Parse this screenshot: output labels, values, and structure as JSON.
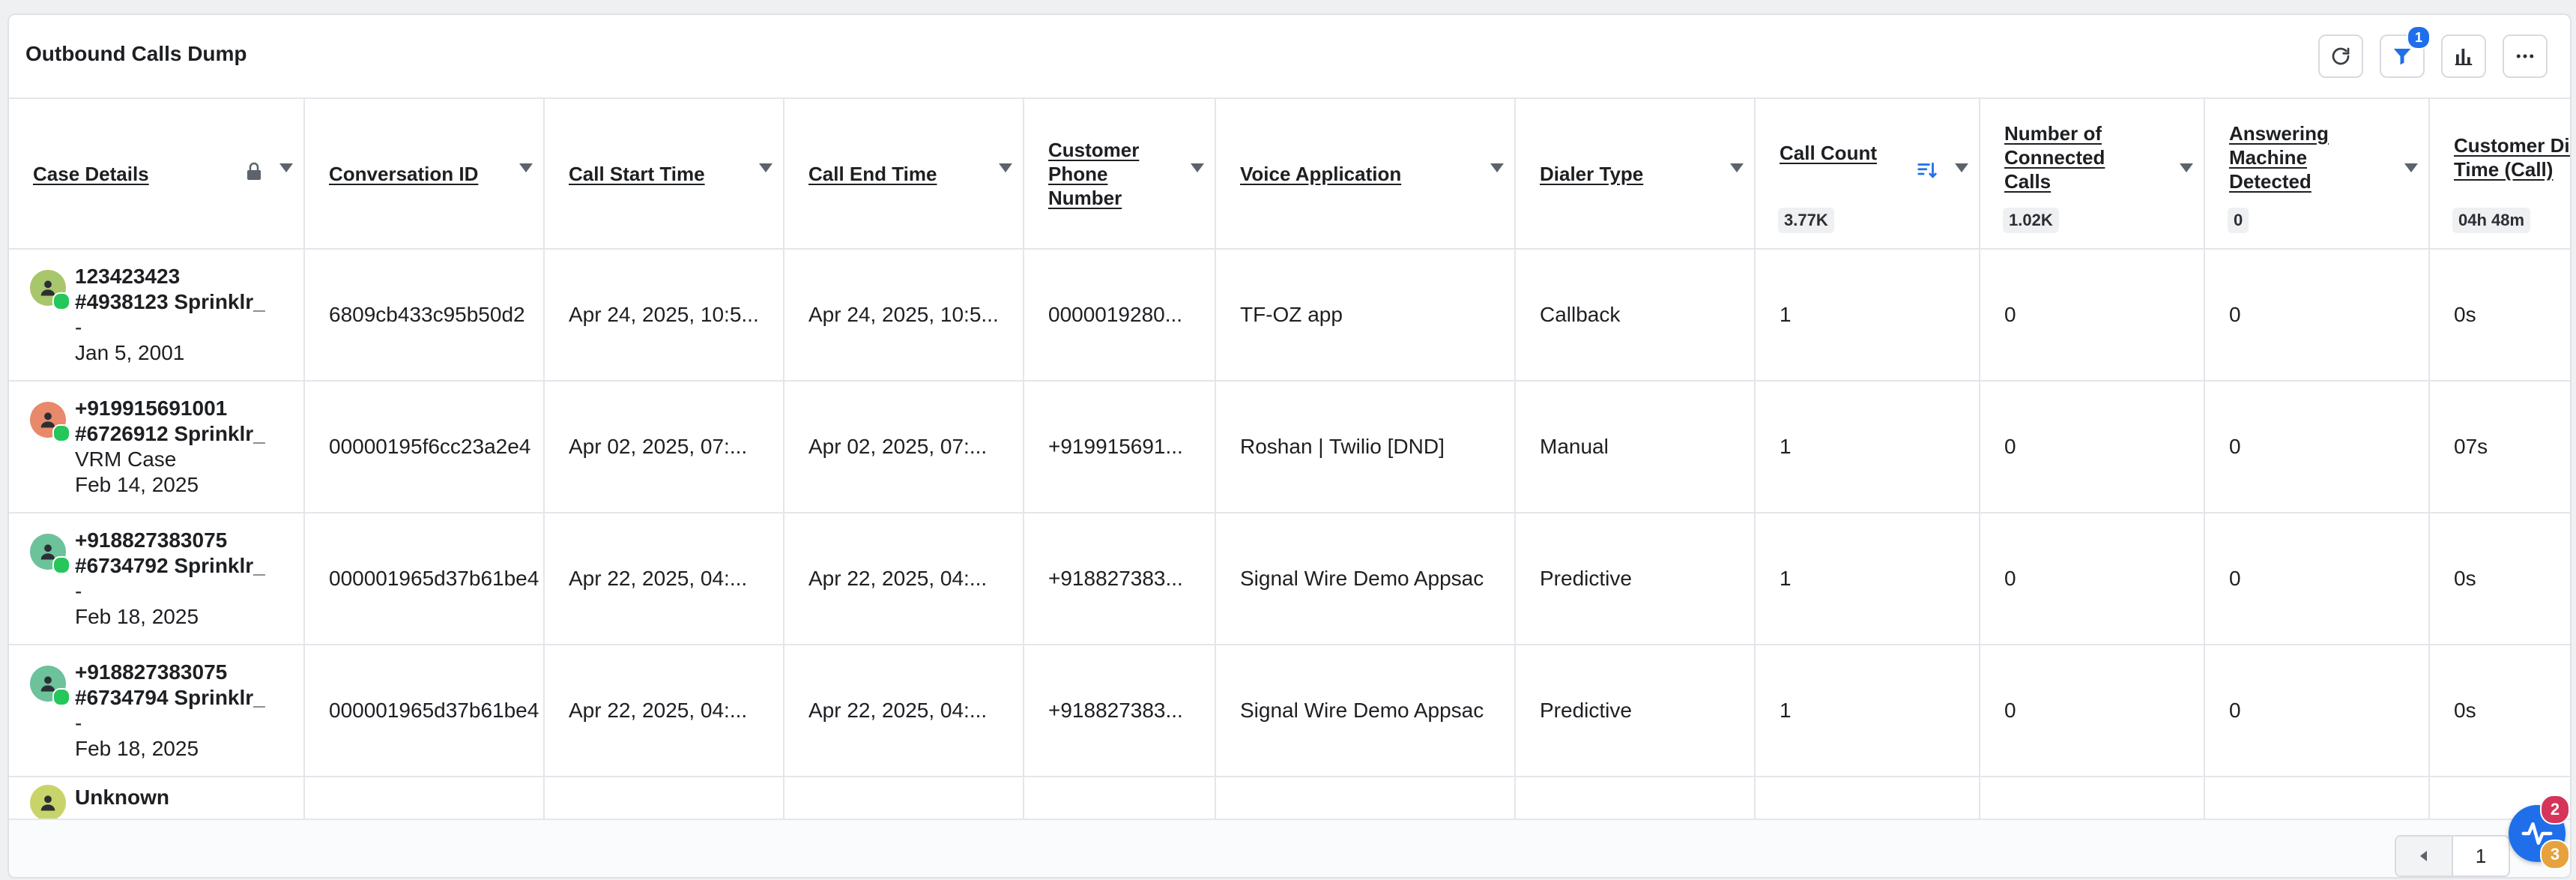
{
  "widget": {
    "title": "Outbound Calls Dump",
    "filter_badge": "1"
  },
  "columns": [
    {
      "label": "Case Details",
      "agg": ""
    },
    {
      "label": "Conversation ID",
      "agg": ""
    },
    {
      "label": "Call Start Time",
      "agg": ""
    },
    {
      "label": "Call End Time",
      "agg": ""
    },
    {
      "label": "Customer Phone Number",
      "agg": ""
    },
    {
      "label": "Voice Application",
      "agg": ""
    },
    {
      "label": "Dialer Type",
      "agg": ""
    },
    {
      "label": "Call Count",
      "agg": "3.77K"
    },
    {
      "label": "Number of Connected Calls",
      "agg": "1.02K"
    },
    {
      "label": "Answering Machine Detected",
      "agg": "0"
    },
    {
      "label": "Customer Dial Time (Call)",
      "agg": "04h 48m"
    }
  ],
  "rows": [
    {
      "case": {
        "line1": "123423423",
        "line2": "#4938123 Sprinklr_",
        "line3": "-",
        "line4": "Jan 5, 2001",
        "avatar_color": "#a8c66c"
      },
      "conversation_id": "6809cb433c95b50d2",
      "call_start": "Apr 24, 2025, 10:5...",
      "call_end": "Apr 24, 2025, 10:5...",
      "phone": "0000019280...",
      "voice_app": "TF-OZ app",
      "dialer": "Callback",
      "call_count": "1",
      "connected": "0",
      "amd": "0",
      "dial_time": "0s"
    },
    {
      "case": {
        "line1": "+919915691001",
        "line2": "#6726912 Sprinklr_",
        "line3": "VRM Case",
        "line4": "Feb 14, 2025",
        "avatar_color": "#e8896b"
      },
      "conversation_id": "00000195f6cc23a2e4",
      "call_start": "Apr 02, 2025, 07:...",
      "call_end": "Apr 02, 2025, 07:...",
      "phone": "+919915691...",
      "voice_app": "Roshan | Twilio [DND]",
      "dialer": "Manual",
      "call_count": "1",
      "connected": "0",
      "amd": "0",
      "dial_time": "07s"
    },
    {
      "case": {
        "line1": "+918827383075",
        "line2": "#6734792 Sprinklr_",
        "line3": "-",
        "line4": "Feb 18, 2025",
        "avatar_color": "#6cc29a"
      },
      "conversation_id": "000001965d37b61be4",
      "call_start": "Apr 22, 2025, 04:...",
      "call_end": "Apr 22, 2025, 04:...",
      "phone": "+918827383...",
      "voice_app": "Signal Wire Demo Appsac",
      "dialer": "Predictive",
      "call_count": "1",
      "connected": "0",
      "amd": "0",
      "dial_time": "0s"
    },
    {
      "case": {
        "line1": "+918827383075",
        "line2": "#6734794 Sprinklr_",
        "line3": "-",
        "line4": "Feb 18, 2025",
        "avatar_color": "#6cc29a"
      },
      "conversation_id": "000001965d37b61be4",
      "call_start": "Apr 22, 2025, 04:...",
      "call_end": "Apr 22, 2025, 04:...",
      "phone": "+918827383...",
      "voice_app": "Signal Wire Demo Appsac",
      "dialer": "Predictive",
      "call_count": "1",
      "connected": "0",
      "amd": "0",
      "dial_time": "0s"
    }
  ],
  "partial_row": {
    "line1": "Unknown",
    "avatar_color": "#c8d46a"
  },
  "footer": {
    "page": "1",
    "fab_badge_top": "2",
    "fab_badge_bottom": "3"
  },
  "colors": {
    "accent": "#1f6feb",
    "badge_red": "#d6345a",
    "badge_yellow": "#e6a23c",
    "online_green": "#25c65a"
  },
  "icons": [
    "refresh-icon",
    "filter-icon",
    "bar-chart-icon",
    "more-icon",
    "lock-icon",
    "sort-desc-icon",
    "person-icon",
    "chevron-left-icon",
    "pulse-icon"
  ]
}
